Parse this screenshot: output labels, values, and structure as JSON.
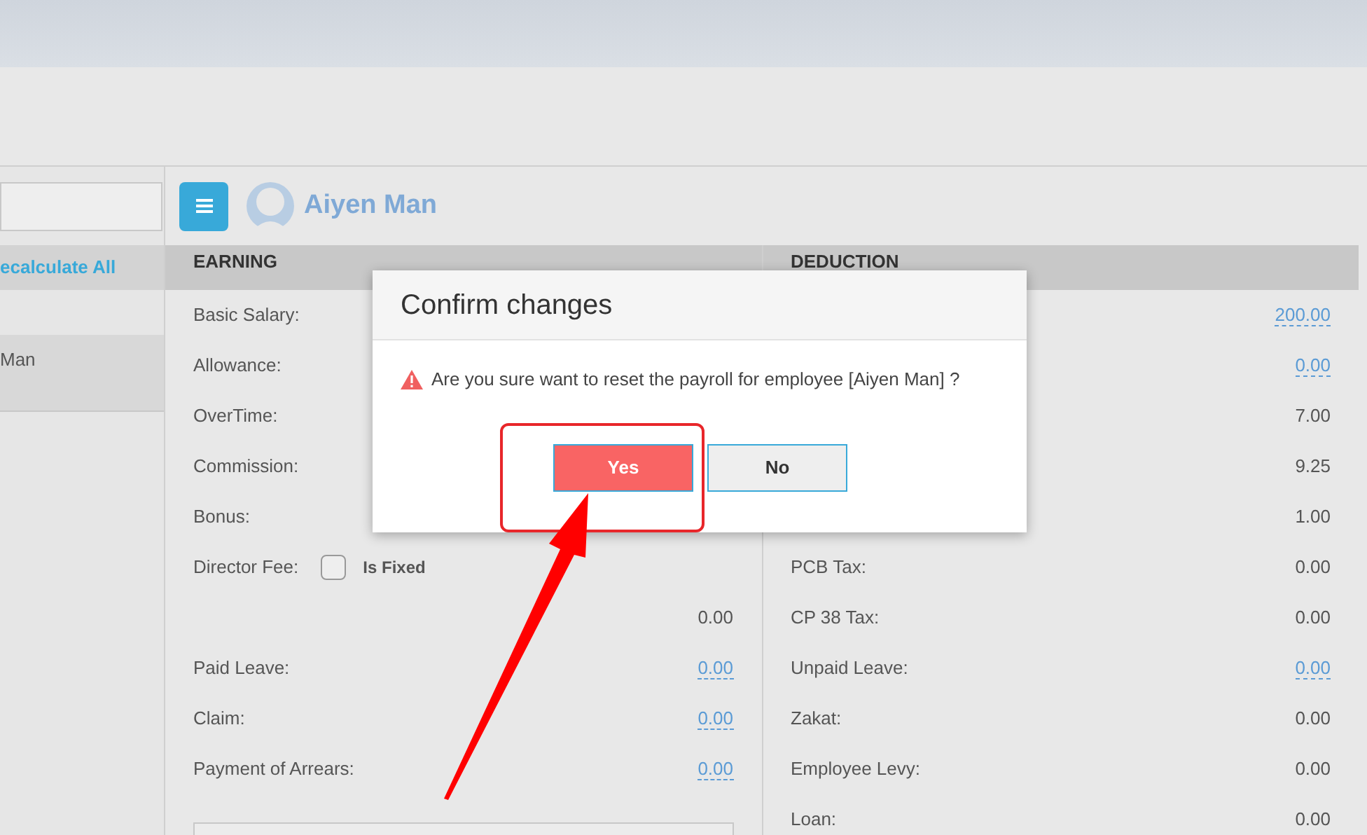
{
  "sidebar": {
    "items": [
      {
        "label": "ecalculate All",
        "kind": "action"
      },
      {
        "kind": "blank"
      },
      {
        "label": "Man",
        "kind": "employee",
        "selected": true
      }
    ]
  },
  "header": {
    "employee_name": "Aiyen Man"
  },
  "earning": {
    "title": "EARNING",
    "rows": [
      {
        "label": "Basic Salary:"
      },
      {
        "label": "Allowance:"
      },
      {
        "label": "OverTime:"
      },
      {
        "label": "Commission:"
      },
      {
        "label": "Bonus:"
      },
      {
        "label": "Director Fee:",
        "checkbox": {
          "label": "Is Fixed",
          "checked": false
        }
      },
      {
        "value": "0.00",
        "link": false
      },
      {
        "label": "Paid Leave:",
        "value": "0.00",
        "link": true
      },
      {
        "label": "Claim:",
        "value": "0.00",
        "link": true
      },
      {
        "label": "Payment of Arrears:",
        "value": "0.00",
        "link": true
      }
    ]
  },
  "deduction": {
    "title": "DEDUCTION",
    "rows": [
      {
        "value": "200.00",
        "link": true
      },
      {
        "value": "0.00",
        "link": true
      },
      {
        "value": "7.00",
        "link": false
      },
      {
        "value": "9.25",
        "link": false
      },
      {
        "value": "1.00",
        "link": false
      },
      {
        "label": "PCB Tax:",
        "value": "0.00",
        "link": false
      },
      {
        "label": "CP 38 Tax:",
        "value": "0.00",
        "link": false
      },
      {
        "label": "Unpaid Leave:",
        "value": "0.00",
        "link": true
      },
      {
        "label": "Zakat:",
        "value": "0.00",
        "link": false
      },
      {
        "label": "Employee Levy:",
        "value": "0.00",
        "link": false
      },
      {
        "label": "Loan:",
        "value": "0.00",
        "link": false
      }
    ]
  },
  "dialog": {
    "title": "Confirm changes",
    "message": "Are you sure want to reset the payroll for employee [Aiyen Man] ?",
    "buttons": [
      {
        "label": "Yes",
        "kind": "primary"
      },
      {
        "label": "No",
        "kind": "secondary"
      }
    ]
  }
}
